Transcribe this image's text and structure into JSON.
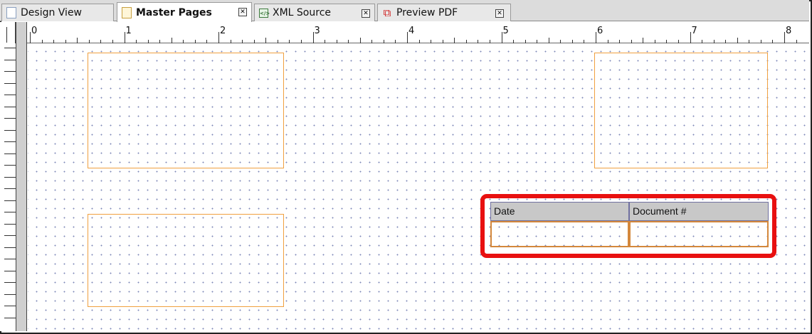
{
  "tabs": [
    {
      "label": "Design View",
      "icon": "document-icon",
      "active": false,
      "closable": false
    },
    {
      "label": "Master Pages",
      "icon": "master-page-icon",
      "active": true,
      "closable": true
    },
    {
      "label": "XML Source",
      "icon": "xml-icon",
      "active": false,
      "closable": true
    },
    {
      "label": "Preview PDF",
      "icon": "pdf-icon",
      "active": false,
      "closable": true
    }
  ],
  "ruler": {
    "labels": [
      "0",
      "1",
      "2",
      "3",
      "4",
      "5",
      "6",
      "7",
      "8"
    ]
  },
  "table": {
    "headers": [
      "Date",
      "Document #"
    ],
    "rows": [
      [
        "",
        ""
      ]
    ]
  },
  "colors": {
    "frame_border": "#f0a040",
    "highlight": "#e81010",
    "header_fill": "#c8c8c8"
  }
}
